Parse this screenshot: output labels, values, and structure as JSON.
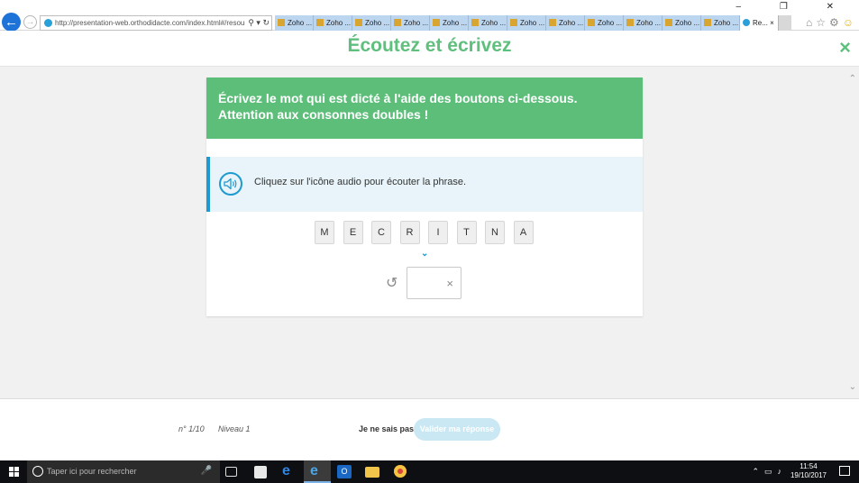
{
  "browser": {
    "url": "http://presentation-web.orthodidacte.com/index.html#/resour",
    "tabs": [
      "Zoho ...",
      "Zoho ...",
      "Zoho ...",
      "Zoho ...",
      "Zoho ...",
      "Zoho ...",
      "Zoho ...",
      "Zoho ...",
      "Zoho ...",
      "Zoho ...",
      "Zoho ...",
      "Zoho ..."
    ],
    "active_tab": "Re...",
    "active_tab_close": "×",
    "window_controls": "–  ❐  ✕"
  },
  "header": {
    "title": "Écoutez et écrivez",
    "close_glyph": "×"
  },
  "exercise": {
    "instruction": "Écrivez le mot qui est dicté à l'aide des boutons ci-dessous. Attention aux consonnes doubles !",
    "audio_prompt": "Cliquez sur l'icône audio pour écouter la phrase.",
    "letters": [
      "M",
      "E",
      "C",
      "R",
      "I",
      "T",
      "N",
      "A"
    ],
    "answer_value": "",
    "clear_glyph": "×",
    "undo_glyph": "↺",
    "chevron_glyph": "⌄"
  },
  "footer": {
    "counter": "n° 1/10",
    "level": "Niveau 1",
    "dont_know": "Je ne sais pas",
    "validate": "Valider ma réponse"
  },
  "taskbar": {
    "search_placeholder": "Taper ici pour rechercher",
    "time": "11:54",
    "date": "19/10/2017"
  },
  "colors": {
    "accent_green": "#5cbe79",
    "accent_blue": "#1e9ad0",
    "validate_disabled": "#c9e8f3"
  }
}
